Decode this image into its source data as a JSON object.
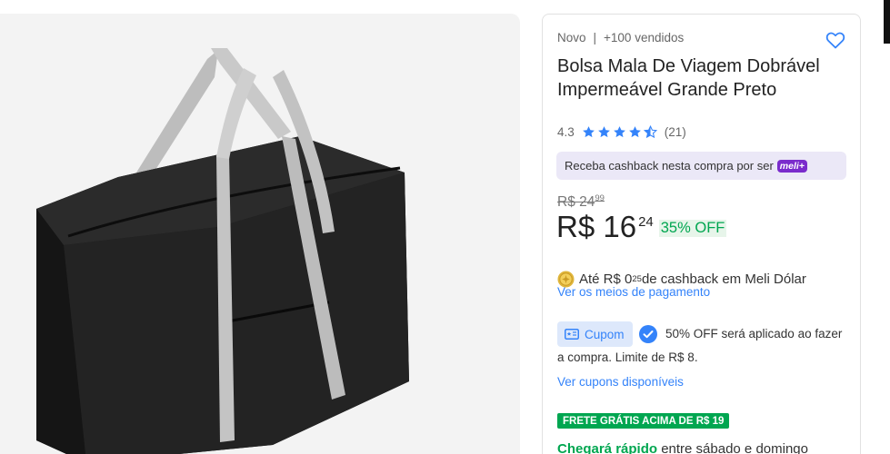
{
  "product": {
    "condition": "Novo",
    "separator": "|",
    "sold": "+100 vendidos",
    "title": "Bolsa Mala De Viagem Dobrável Impermeável Grande Preto",
    "rating": {
      "score": "4.3",
      "value": 4.3,
      "max": 5,
      "count": "(21)"
    },
    "image_alt": "Bolsa de viagem preta com alças cinza"
  },
  "cashback_banner": {
    "text": "Receba cashback nesta compra por ser",
    "badge": "meli+"
  },
  "pricing": {
    "old_price": "R$ 24",
    "old_cents": "99",
    "price": "R$ 16",
    "cents": "24",
    "discount": "35% OFF"
  },
  "meli_dolar": {
    "prefix": "Até R$ 0",
    "cents": "25",
    "suffix": " de cashback em Meli Dólar"
  },
  "links": {
    "payment_methods": "Ver os meios de pagamento",
    "coupons": "Ver cupons disponíveis"
  },
  "coupon": {
    "tag": "Cupom",
    "text_line1": "50% OFF será aplicado ao fazer",
    "text_line2": "a compra. Limite de R$ 8."
  },
  "shipping": {
    "badge": "FRETE GRÁTIS ACIMA DE R$ 19",
    "fast": "Chegará rápido",
    "window": " entre sábado e domingo"
  },
  "colors": {
    "link_blue": "#3483fa",
    "green": "#00a650",
    "meli_purple": "#7a2bcc",
    "star_blue": "#3483fa"
  },
  "icons": [
    "heart-icon",
    "star-icon",
    "coin-icon",
    "coupon-icon",
    "check-circle-icon"
  ]
}
